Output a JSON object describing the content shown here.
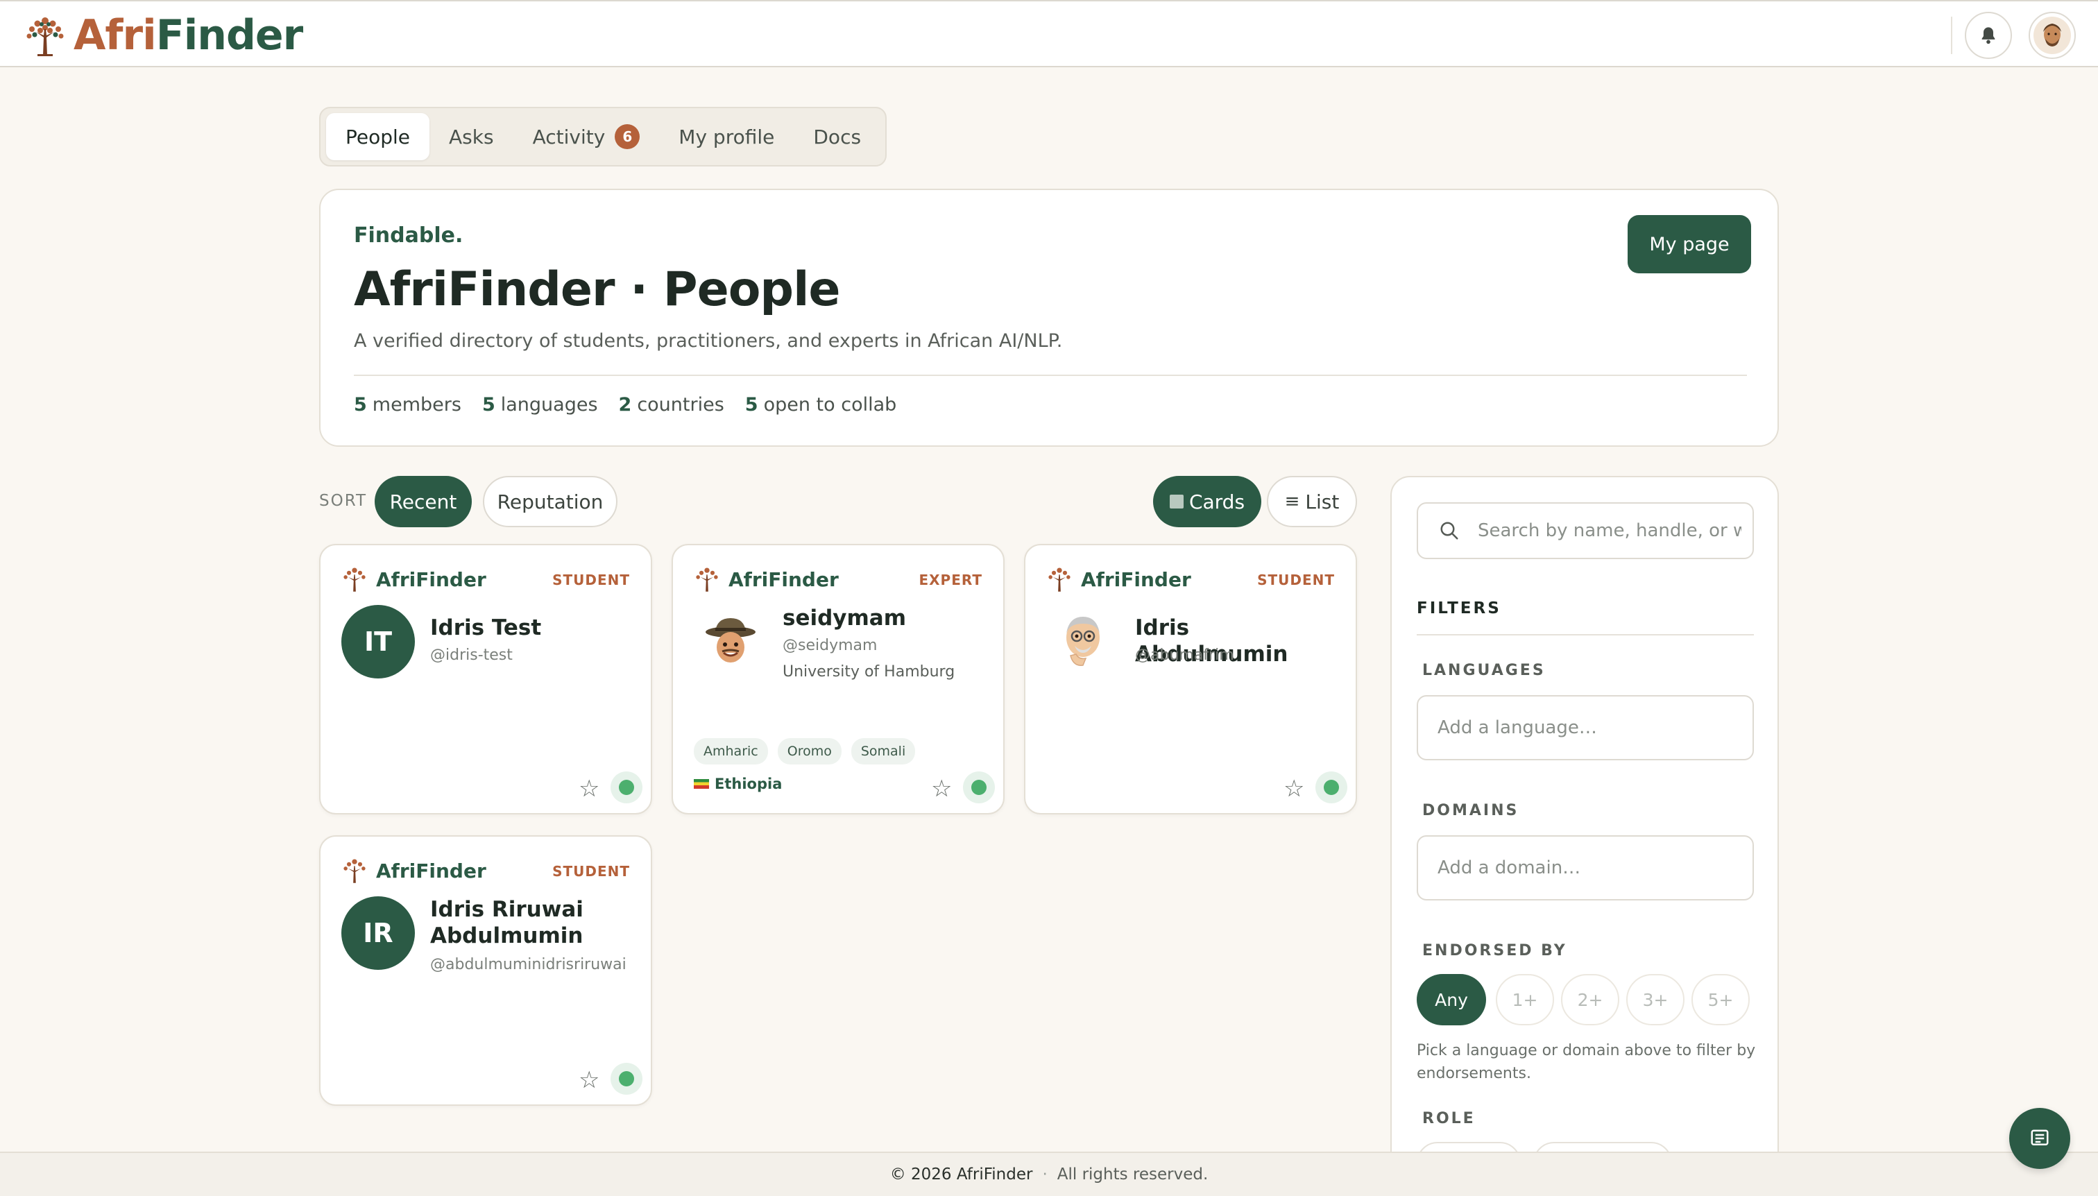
{
  "brand": {
    "part1": "Afri",
    "part2": "Finder",
    "card_name": "AfriFinder"
  },
  "header": {
    "bell_icon": "bell-icon",
    "avatar_icon": "user-avatar"
  },
  "tabs": [
    {
      "label": "People",
      "active": true
    },
    {
      "label": "Asks"
    },
    {
      "label": "Activity",
      "badge": "6"
    },
    {
      "label": "My profile"
    },
    {
      "label": "Docs"
    }
  ],
  "hero": {
    "kicker": "Findable.",
    "title": "AfriFinder · People",
    "subtitle": "A verified directory of students, practitioners, and experts in African AI/NLP.",
    "button": "My page",
    "stats": [
      {
        "n": "5",
        "label": "members"
      },
      {
        "n": "5",
        "label": "languages"
      },
      {
        "n": "2",
        "label": "countries"
      },
      {
        "n": "5",
        "label": "open to collab"
      }
    ]
  },
  "sort": {
    "label": "SORT",
    "recent": "Recent",
    "reputation": "Reputation"
  },
  "view": {
    "cards": "Cards",
    "list": "List"
  },
  "cards": [
    {
      "role": "STUDENT",
      "initials": "IT",
      "name": "Idris Test",
      "handle": "@idris-test"
    },
    {
      "role": "EXPERT",
      "name": "seidymam",
      "handle": "@seidymam",
      "org": "University of Hamburg",
      "tags": [
        "Amharic",
        "Oromo",
        "Somali"
      ],
      "country": "Ethiopia"
    },
    {
      "role": "STUDENT",
      "name": "Idris Abdulmumin",
      "handle": "@abumafrim"
    },
    {
      "role": "STUDENT",
      "initials": "IR",
      "name": "Idris Riruwai Abdulmumin",
      "handle": "@abdulmuminidrisriruwai"
    }
  ],
  "sidebar": {
    "search_placeholder": "Search by name, handle, or w",
    "filters": "FILTERS",
    "languages": "LANGUAGES",
    "languages_ph": "Add a language…",
    "domains": "DOMAINS",
    "domains_ph": "Add a domain…",
    "endorsed_by": "ENDORSED BY",
    "endorse_options": [
      "Any",
      "1+",
      "2+",
      "3+",
      "5+"
    ],
    "endorse_help": "Pick a language or domain above to filter by endorsements.",
    "role": "ROLE"
  },
  "footer": {
    "copyright": "© 2026 AfriFinder",
    "sep": "·",
    "rights": "All rights reserved."
  },
  "colors": {
    "brand_green": "#2b5a45",
    "brand_orange": "#b5613a",
    "online": "#4caf6e"
  }
}
